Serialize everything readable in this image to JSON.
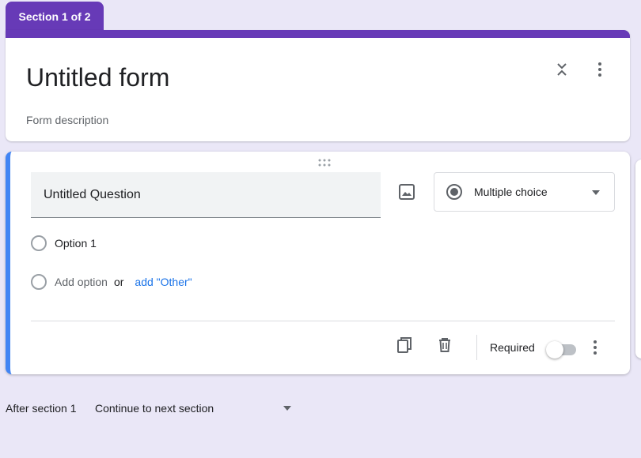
{
  "section_tab": {
    "label": "Section 1 of 2"
  },
  "title_card": {
    "title": "Untitled form",
    "description": "Form description"
  },
  "question": {
    "title": "Untitled Question",
    "type_label": "Multiple choice",
    "options": [
      {
        "label": "Option 1"
      }
    ],
    "add_option_label": "Add option",
    "or_label": "or",
    "add_other_label": "add \"Other\"",
    "required_label": "Required",
    "required": false
  },
  "after_section": {
    "label": "After section 1",
    "value": "Continue to next section"
  },
  "colors": {
    "accent": "#673ab7",
    "active_border": "#4285f4",
    "link": "#1a73e8",
    "background": "#eae7f7"
  },
  "icons": [
    "collapse-icon",
    "more-vert-icon",
    "drag-handle-icon",
    "image-icon",
    "radio-button-icon",
    "dropdown-caret-icon",
    "copy-icon",
    "delete-icon"
  ]
}
